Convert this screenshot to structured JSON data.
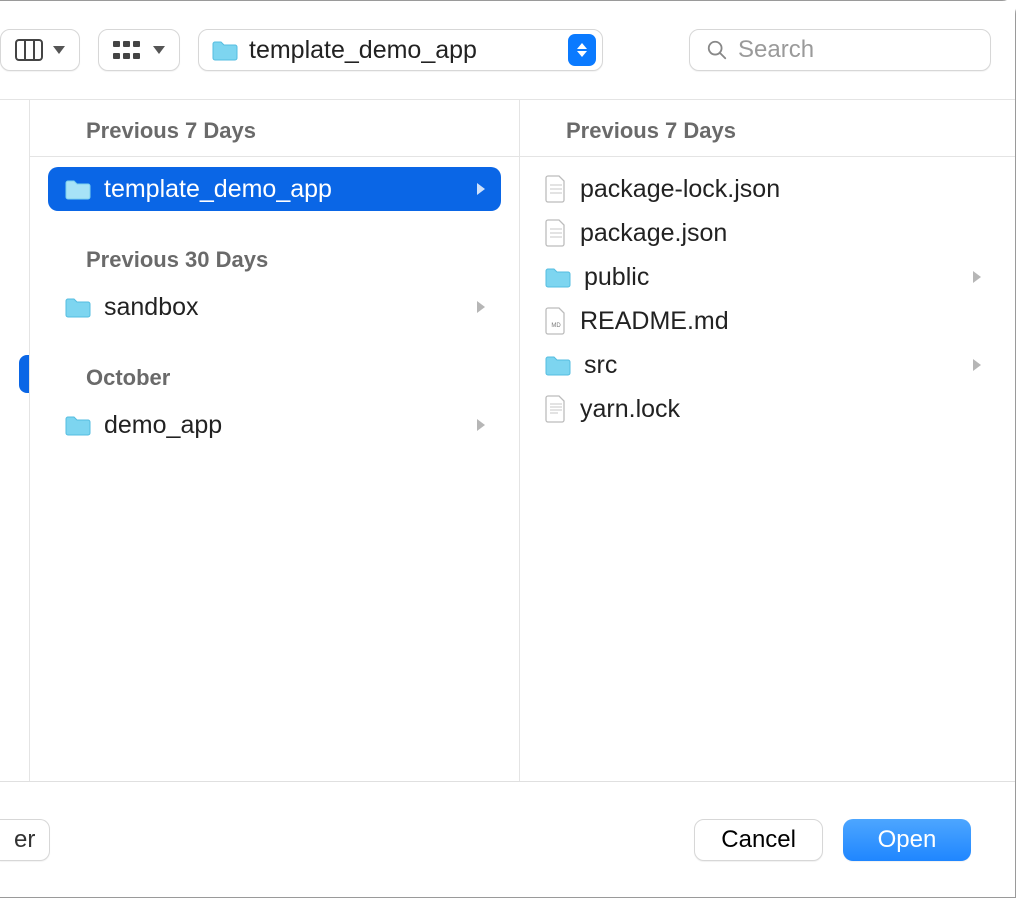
{
  "toolbar": {
    "location_label": "template_demo_app",
    "search_placeholder": "Search"
  },
  "left_column": {
    "sections": [
      {
        "title": "Previous 7 Days",
        "items": [
          {
            "name": "template_demo_app",
            "type": "folder",
            "selected": true,
            "is_parent": true
          }
        ]
      },
      {
        "title": "Previous 30 Days",
        "items": [
          {
            "name": "sandbox",
            "type": "folder",
            "is_parent": true
          }
        ]
      },
      {
        "title": "October",
        "items": [
          {
            "name": "demo_app",
            "type": "folder",
            "is_parent": true
          }
        ]
      }
    ]
  },
  "right_column": {
    "sections": [
      {
        "title": "Previous 7 Days",
        "items": [
          {
            "name": "package-lock.json",
            "type": "file"
          },
          {
            "name": "package.json",
            "type": "file"
          },
          {
            "name": "public",
            "type": "folder",
            "is_parent": true
          },
          {
            "name": "README.md",
            "type": "file-md"
          },
          {
            "name": "src",
            "type": "folder",
            "is_parent": true
          },
          {
            "name": "yarn.lock",
            "type": "file-text"
          }
        ]
      }
    ]
  },
  "bottom": {
    "partial_button": "er",
    "cancel_label": "Cancel",
    "open_label": "Open"
  }
}
